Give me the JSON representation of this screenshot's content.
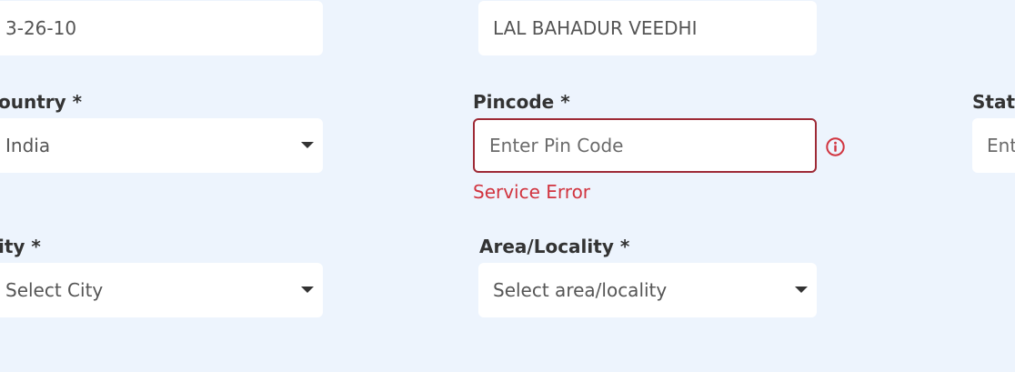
{
  "address": {
    "line1_value": "3-26-10",
    "line2_value": "LAL BAHADUR VEEDHI"
  },
  "country": {
    "label": "ountry *",
    "selected": "India"
  },
  "pincode": {
    "label": "Pincode *",
    "placeholder": "Enter Pin Code",
    "error": "Service Error"
  },
  "state": {
    "label": "Stat",
    "placeholder": "Ent"
  },
  "city": {
    "label": "ity *",
    "selected": "Select City"
  },
  "area": {
    "label": "Area/Locality *",
    "selected": "Select area/locality"
  },
  "colors": {
    "background": "#edf4fd",
    "error": "#d1343f",
    "error_border": "#9e2a36"
  }
}
